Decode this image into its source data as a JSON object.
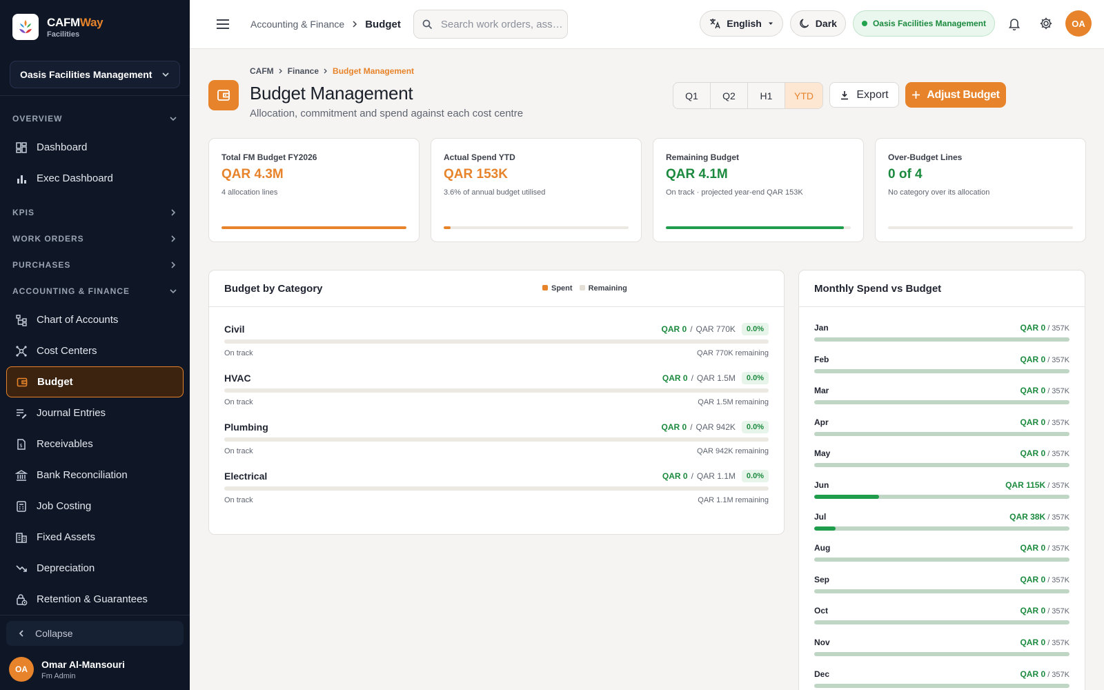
{
  "app": {
    "name_main": "CAFM",
    "name_accent": "Way",
    "subtitle": "Facilities"
  },
  "sidebar": {
    "org": "Oasis Facilities Management",
    "sections": {
      "overview": "OVERVIEW",
      "kpis": "KPIS",
      "work_orders": "WORK ORDERS",
      "purchases": "PURCHASES",
      "accounting": "ACCOUNTING & FINANCE"
    },
    "items": {
      "dashboard": "Dashboard",
      "exec_dashboard": "Exec Dashboard",
      "chart_of_accounts": "Chart of Accounts",
      "cost_centers": "Cost Centers",
      "budget": "Budget",
      "journal_entries": "Journal Entries",
      "receivables": "Receivables",
      "bank_reconciliation": "Bank Reconciliation",
      "job_costing": "Job Costing",
      "fixed_assets": "Fixed Assets",
      "depreciation": "Depreciation",
      "retention": "Retention & Guarantees"
    },
    "collapse": "Collapse",
    "user": {
      "initials": "OA",
      "name": "Omar Al-Mansouri",
      "role": "Fm Admin"
    }
  },
  "topbar": {
    "breadcrumb_parent": "Accounting & Finance",
    "breadcrumb_current": "Budget",
    "search_placeholder": "Search work orders, ass…",
    "language": "English",
    "theme": "Dark",
    "org": "Oasis Facilities Management",
    "avatar": "OA"
  },
  "page": {
    "breadcrumb": [
      "CAFM",
      "Finance",
      "Budget Management"
    ],
    "title": "Budget Management",
    "subtitle": "Allocation, commitment and spend against each cost centre",
    "periods": [
      "Q1",
      "Q2",
      "H1",
      "YTD"
    ],
    "active_period": "YTD",
    "export": "Export",
    "adjust": "Adjust Budget"
  },
  "kpis": [
    {
      "label": "Total FM Budget FY2026",
      "value": "QAR 4.3M",
      "hint": "4 allocation lines",
      "progress": 1.0,
      "color": "#e7832a"
    },
    {
      "label": "Actual Spend YTD",
      "value": "QAR 153K",
      "hint": "3.6% of annual budget utilised",
      "progress": 0.036,
      "color": "#e7832a"
    },
    {
      "label": "Remaining Budget",
      "value": "QAR 4.1M",
      "hint": "On track · projected year-end QAR 153K",
      "progress": 0.964,
      "color": "#1f9d4c"
    },
    {
      "label": "Over-Budget Lines",
      "value": "0 of 4",
      "hint": "No category over its allocation",
      "progress": 0,
      "color": "#1f9d4c"
    }
  ],
  "category_panel": {
    "title": "Budget by Category",
    "legend_spent": "Spent",
    "legend_remaining": "Remaining",
    "items": [
      {
        "name": "Civil",
        "spent": "QAR 0",
        "budget": "QAR 770K",
        "pct": "0.0%",
        "status": "On track",
        "remaining": "QAR 770K remaining",
        "progress": 0
      },
      {
        "name": "HVAC",
        "spent": "QAR 0",
        "budget": "QAR 1.5M",
        "pct": "0.0%",
        "status": "On track",
        "remaining": "QAR 1.5M remaining",
        "progress": 0
      },
      {
        "name": "Plumbing",
        "spent": "QAR 0",
        "budget": "QAR 942K",
        "pct": "0.0%",
        "status": "On track",
        "remaining": "QAR 942K remaining",
        "progress": 0
      },
      {
        "name": "Electrical",
        "spent": "QAR 0",
        "budget": "QAR 1.1M",
        "pct": "0.0%",
        "status": "On track",
        "remaining": "QAR 1.1M remaining",
        "progress": 0
      }
    ]
  },
  "monthly_panel": {
    "title": "Monthly Spend vs Budget",
    "budget_label": "/ 357K",
    "months": [
      {
        "m": "Jan",
        "spent": "QAR 0",
        "progress": 0
      },
      {
        "m": "Feb",
        "spent": "QAR 0",
        "progress": 0
      },
      {
        "m": "Mar",
        "spent": "QAR 0",
        "progress": 0
      },
      {
        "m": "Apr",
        "spent": "QAR 0",
        "progress": 0
      },
      {
        "m": "May",
        "spent": "QAR 0",
        "progress": 0
      },
      {
        "m": "Jun",
        "spent": "QAR 115K",
        "progress": 0.255
      },
      {
        "m": "Jul",
        "spent": "QAR 38K",
        "progress": 0.085
      },
      {
        "m": "Aug",
        "spent": "QAR 0",
        "progress": 0
      },
      {
        "m": "Sep",
        "spent": "QAR 0",
        "progress": 0
      },
      {
        "m": "Oct",
        "spent": "QAR 0",
        "progress": 0
      },
      {
        "m": "Nov",
        "spent": "QAR 0",
        "progress": 0
      },
      {
        "m": "Dec",
        "spent": "QAR 0",
        "progress": 0
      }
    ]
  }
}
